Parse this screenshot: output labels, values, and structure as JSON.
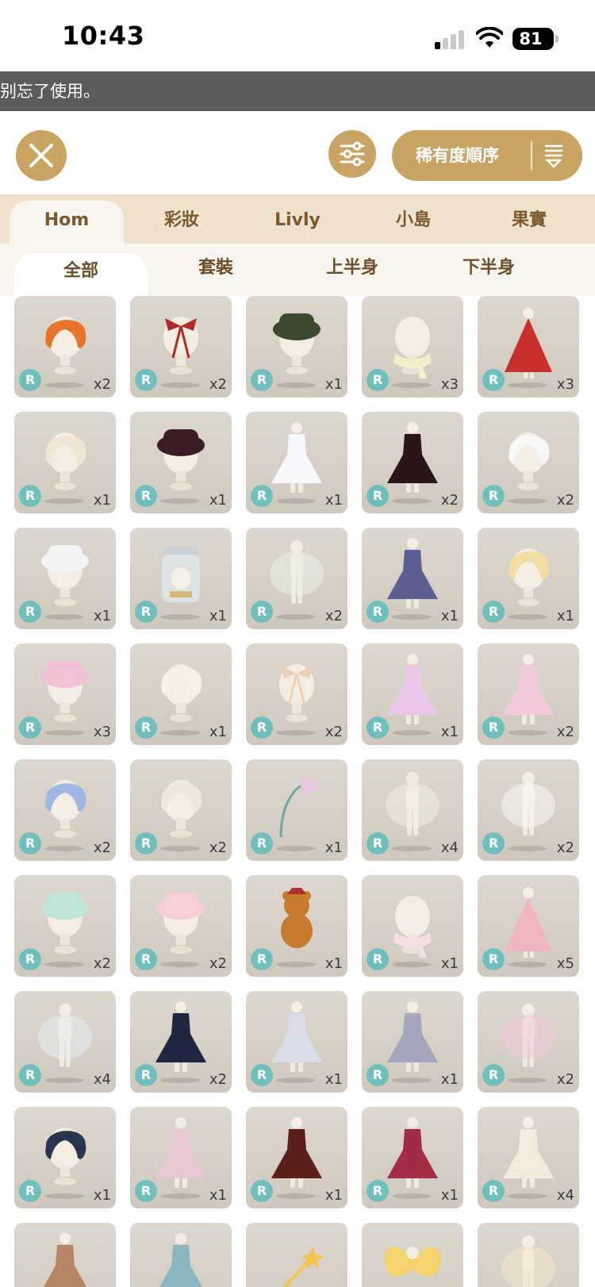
{
  "status_bar": {
    "time": "10:43",
    "battery": "81"
  },
  "notice": "别忘了使用。",
  "toolbar": {
    "sort_label": "稀有度順序"
  },
  "main_tabs": [
    "Hom",
    "彩妝",
    "Livly",
    "小島",
    "果實"
  ],
  "sub_tabs": [
    "全部",
    "套裝",
    "上半身",
    "下半身"
  ],
  "items": [
    {
      "type": "hair",
      "color": "#e8742a",
      "rarity": "R",
      "qty": "x2"
    },
    {
      "type": "ribbon",
      "color": "#b02a2a",
      "rarity": "R",
      "qty": "x2"
    },
    {
      "type": "hat",
      "color": "#3b4a2e",
      "rarity": "R",
      "qty": "x1"
    },
    {
      "type": "scarf",
      "color": "#f4efc9",
      "rarity": "R",
      "qty": "x3"
    },
    {
      "type": "cape",
      "color": "#c9302c",
      "rarity": "R",
      "qty": "x3"
    },
    {
      "type": "hair",
      "color": "#f1e6d4",
      "rarity": "R",
      "qty": "x1"
    },
    {
      "type": "hat",
      "color": "#3a1d22",
      "rarity": "R",
      "qty": "x1"
    },
    {
      "type": "dress",
      "color": "#f7f7fb",
      "rarity": "R",
      "qty": "x1"
    },
    {
      "type": "dress",
      "color": "#2a1516",
      "rarity": "R",
      "qty": "x2"
    },
    {
      "type": "hair",
      "color": "#f7f7f7",
      "rarity": "R",
      "qty": "x2"
    },
    {
      "type": "hat",
      "color": "#f4f4f6",
      "rarity": "R",
      "qty": "x1"
    },
    {
      "type": "jar",
      "color": "#dfe7ea",
      "rarity": "R",
      "qty": "x1"
    },
    {
      "type": "body",
      "color": "#ecf0e6",
      "rarity": "R",
      "qty": "x2"
    },
    {
      "type": "dress",
      "color": "#5b5f8f",
      "rarity": "R",
      "qty": "x1"
    },
    {
      "type": "hair",
      "color": "#f3dca1",
      "rarity": "R",
      "qty": "x1"
    },
    {
      "type": "hat",
      "color": "#f2bfd6",
      "rarity": "R",
      "qty": "x3"
    },
    {
      "type": "hair",
      "color": "#f6f1e4",
      "rarity": "R",
      "qty": "x1"
    },
    {
      "type": "ribbon",
      "color": "#e9d2b6",
      "rarity": "R",
      "qty": "x2"
    },
    {
      "type": "dress",
      "color": "#e9c7e8",
      "rarity": "R",
      "qty": "x1"
    },
    {
      "type": "dress",
      "color": "#f3c9dc",
      "rarity": "R",
      "qty": "x2"
    },
    {
      "type": "hair",
      "color": "#9fb7e3",
      "rarity": "R",
      "qty": "x2"
    },
    {
      "type": "hair",
      "color": "#efe6dc",
      "rarity": "R",
      "qty": "x2"
    },
    {
      "type": "flower",
      "color": "#e8c7dc",
      "rarity": "R",
      "qty": "x1"
    },
    {
      "type": "body",
      "color": "#f2ece2",
      "rarity": "R",
      "qty": "x4"
    },
    {
      "type": "body",
      "color": "#f7f7f3",
      "rarity": "R",
      "qty": "x2"
    },
    {
      "type": "hat",
      "color": "#bfe6d7",
      "rarity": "R",
      "qty": "x2"
    },
    {
      "type": "hat",
      "color": "#f6cfd5",
      "rarity": "R",
      "qty": "x2"
    },
    {
      "type": "bear",
      "color": "#c77b2e",
      "rarity": "R",
      "qty": "x1"
    },
    {
      "type": "scarf",
      "color": "#f6dfe1",
      "rarity": "R",
      "qty": "x1"
    },
    {
      "type": "cape",
      "color": "#efb7bd",
      "rarity": "R",
      "qty": "x5"
    },
    {
      "type": "body",
      "color": "#e7edf1",
      "rarity": "R",
      "qty": "x4"
    },
    {
      "type": "dress",
      "color": "#1d2740",
      "rarity": "R",
      "qty": "x2"
    },
    {
      "type": "dress",
      "color": "#d9dce8",
      "rarity": "R",
      "qty": "x1"
    },
    {
      "type": "dress",
      "color": "#a5a5bd",
      "rarity": "R",
      "qty": "x1"
    },
    {
      "type": "body",
      "color": "#f0c9d6",
      "rarity": "R",
      "qty": "x2"
    },
    {
      "type": "hair",
      "color": "#2a3550",
      "rarity": "R",
      "qty": "x1"
    },
    {
      "type": "dress",
      "color": "#e7c8d1",
      "rarity": "R",
      "qty": "x1"
    },
    {
      "type": "dress",
      "color": "#5b1f1c",
      "rarity": "R",
      "qty": "x1"
    },
    {
      "type": "dress",
      "color": "#a32d45",
      "rarity": "R",
      "qty": "x1"
    },
    {
      "type": "dress",
      "color": "#f3eadb",
      "rarity": "R",
      "qty": "x4"
    },
    {
      "type": "dress",
      "color": "#b48663",
      "rarity": "",
      "qty": ""
    },
    {
      "type": "dress",
      "color": "#8ab7c0",
      "rarity": "",
      "qty": ""
    },
    {
      "type": "wand",
      "color": "#f1c64a",
      "rarity": "",
      "qty": ""
    },
    {
      "type": "wings",
      "color": "#f5d36c",
      "rarity": "",
      "qty": ""
    },
    {
      "type": "body",
      "color": "#f4e6c8",
      "rarity": "",
      "qty": ""
    }
  ]
}
